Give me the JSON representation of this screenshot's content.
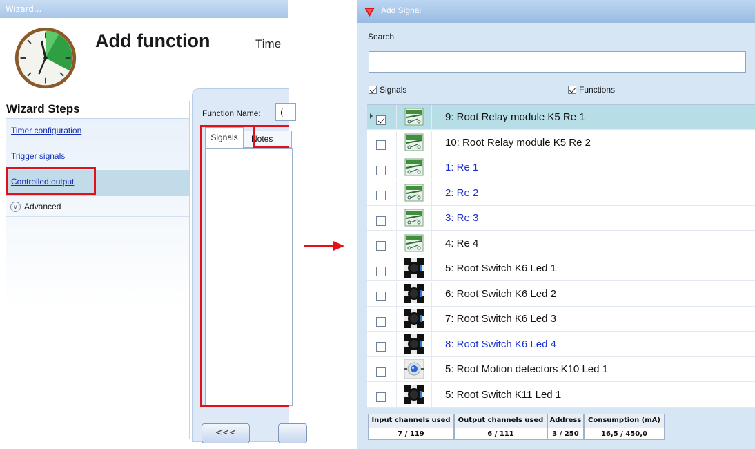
{
  "wizard": {
    "window_title": "Wizard...",
    "title": "Add function",
    "subtitle": "Time",
    "steps_heading": "Wizard Steps",
    "steps": [
      "Timer configuration",
      "Trigger signals",
      "Controlled output"
    ],
    "selected_step": "Controlled output",
    "advanced_label": "Advanced",
    "function_name_label": "Function Name:",
    "function_name_value": "(",
    "tabs": [
      "Signals",
      "Notes"
    ],
    "back_button": "<<<"
  },
  "add_signal": {
    "window_title": "Add Signal",
    "search_label": "Search",
    "search_value": "",
    "filters": [
      {
        "label": "Signals",
        "checked": true
      },
      {
        "label": "Functions",
        "checked": true
      }
    ],
    "rows": [
      {
        "label": "9: Root Relay module K5 Re 1",
        "checked": true,
        "selected": true,
        "icon": "relay-icon",
        "text_color": "black"
      },
      {
        "label": "10: Root Relay module K5 Re 2",
        "checked": false,
        "selected": false,
        "icon": "relay-icon",
        "text_color": "black"
      },
      {
        "label": "1: Re 1",
        "checked": false,
        "selected": false,
        "icon": "relay-icon",
        "text_color": "blue"
      },
      {
        "label": "2: Re 2",
        "checked": false,
        "selected": false,
        "icon": "relay-icon",
        "text_color": "blue"
      },
      {
        "label": "3: Re 3",
        "checked": false,
        "selected": false,
        "icon": "relay-icon",
        "text_color": "blue"
      },
      {
        "label": "4: Re 4",
        "checked": false,
        "selected": false,
        "icon": "relay-icon",
        "text_color": "black"
      },
      {
        "label": "5: Root Switch K6 Led 1",
        "checked": false,
        "selected": false,
        "icon": "switch-led-icon",
        "text_color": "black"
      },
      {
        "label": "6: Root Switch K6 Led 2",
        "checked": false,
        "selected": false,
        "icon": "switch-led-icon",
        "text_color": "black"
      },
      {
        "label": "7: Root Switch K6 Led 3",
        "checked": false,
        "selected": false,
        "icon": "switch-led-icon",
        "text_color": "black"
      },
      {
        "label": "8: Root Switch K6 Led 4",
        "checked": false,
        "selected": false,
        "icon": "switch-led-icon",
        "text_color": "blue"
      },
      {
        "label": "5: Root Motion detectors K10 Led 1",
        "checked": false,
        "selected": false,
        "icon": "motion-detector-icon",
        "text_color": "black"
      },
      {
        "label": "5: Root Switch K11 Led 1",
        "checked": false,
        "selected": false,
        "icon": "switch-led-icon",
        "text_color": "black"
      }
    ],
    "stats": [
      {
        "header": "Input channels used",
        "value": "7 / 119"
      },
      {
        "header": "Output channels used",
        "value": "6 / 111"
      },
      {
        "header": "Address",
        "value": "3 / 250"
      },
      {
        "header": "Consumption (mA)",
        "value": "16,5 / 450,0"
      }
    ]
  },
  "colors": {
    "highlight_red": "#e3101a",
    "selected_row": "#b7dde6",
    "link_blue": "#1530b8",
    "signal_blue_text": "#1a2fd0"
  }
}
